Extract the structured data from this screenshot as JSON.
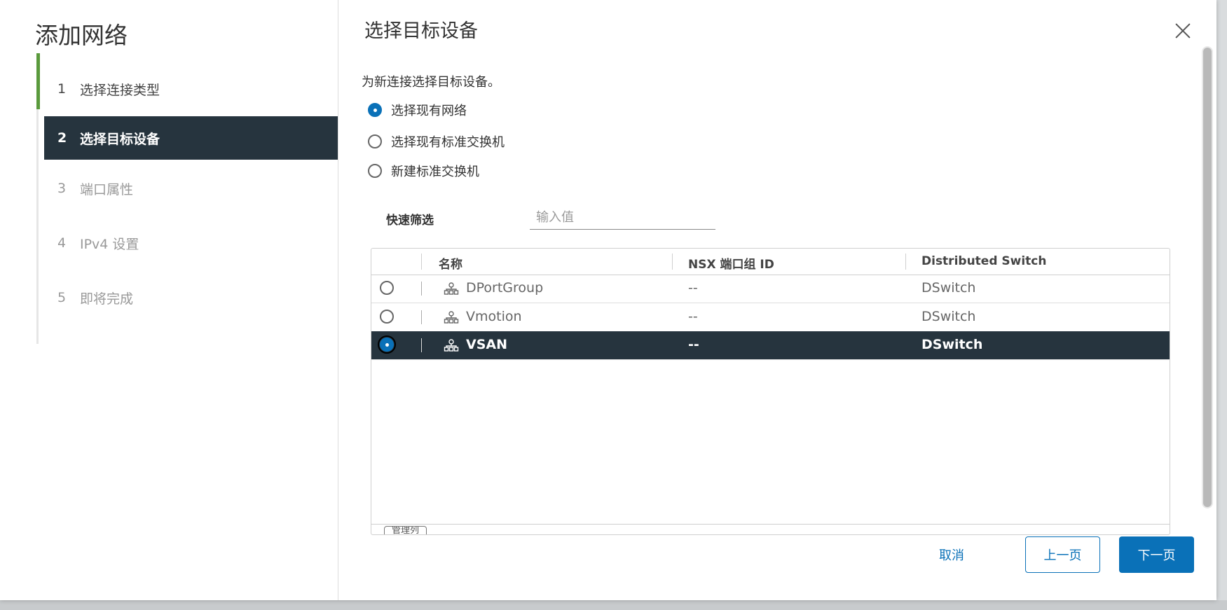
{
  "modal": {
    "title": "添加网络"
  },
  "wizard": {
    "steps": [
      {
        "num": "1",
        "label": "选择连接类型",
        "state": "done"
      },
      {
        "num": "2",
        "label": "选择目标设备",
        "state": "active"
      },
      {
        "num": "3",
        "label": "端口属性",
        "state": "disabled"
      },
      {
        "num": "4",
        "label": "IPv4 设置",
        "state": "disabled"
      },
      {
        "num": "5",
        "label": "即将完成",
        "state": "disabled"
      }
    ]
  },
  "page": {
    "title": "选择目标设备",
    "instruction": "为新连接选择目标设备。",
    "options": [
      {
        "label": "选择现有网络",
        "checked": true
      },
      {
        "label": "选择现有标准交换机",
        "checked": false
      },
      {
        "label": "新建标准交换机",
        "checked": false
      }
    ],
    "filter": {
      "label": "快速筛选",
      "placeholder": "输入值"
    }
  },
  "grid": {
    "columns": [
      "名称",
      "NSX 端口组 ID",
      "Distributed Switch"
    ],
    "rows": [
      {
        "name": "DPortGroup",
        "nsx_id": "--",
        "switch": "DSwitch",
        "selected": false
      },
      {
        "name": "Vmotion",
        "nsx_id": "--",
        "switch": "DSwitch",
        "selected": false
      },
      {
        "name": "VSAN",
        "nsx_id": "--",
        "switch": "DSwitch",
        "selected": true
      }
    ],
    "footer_button": "管理列"
  },
  "footer": {
    "cancel": "取消",
    "prev": "上一页",
    "next": "下一页"
  },
  "colors": {
    "accent": "#0a71b8",
    "selected_row": "#26343e",
    "done_step": "#5a9a3c"
  }
}
